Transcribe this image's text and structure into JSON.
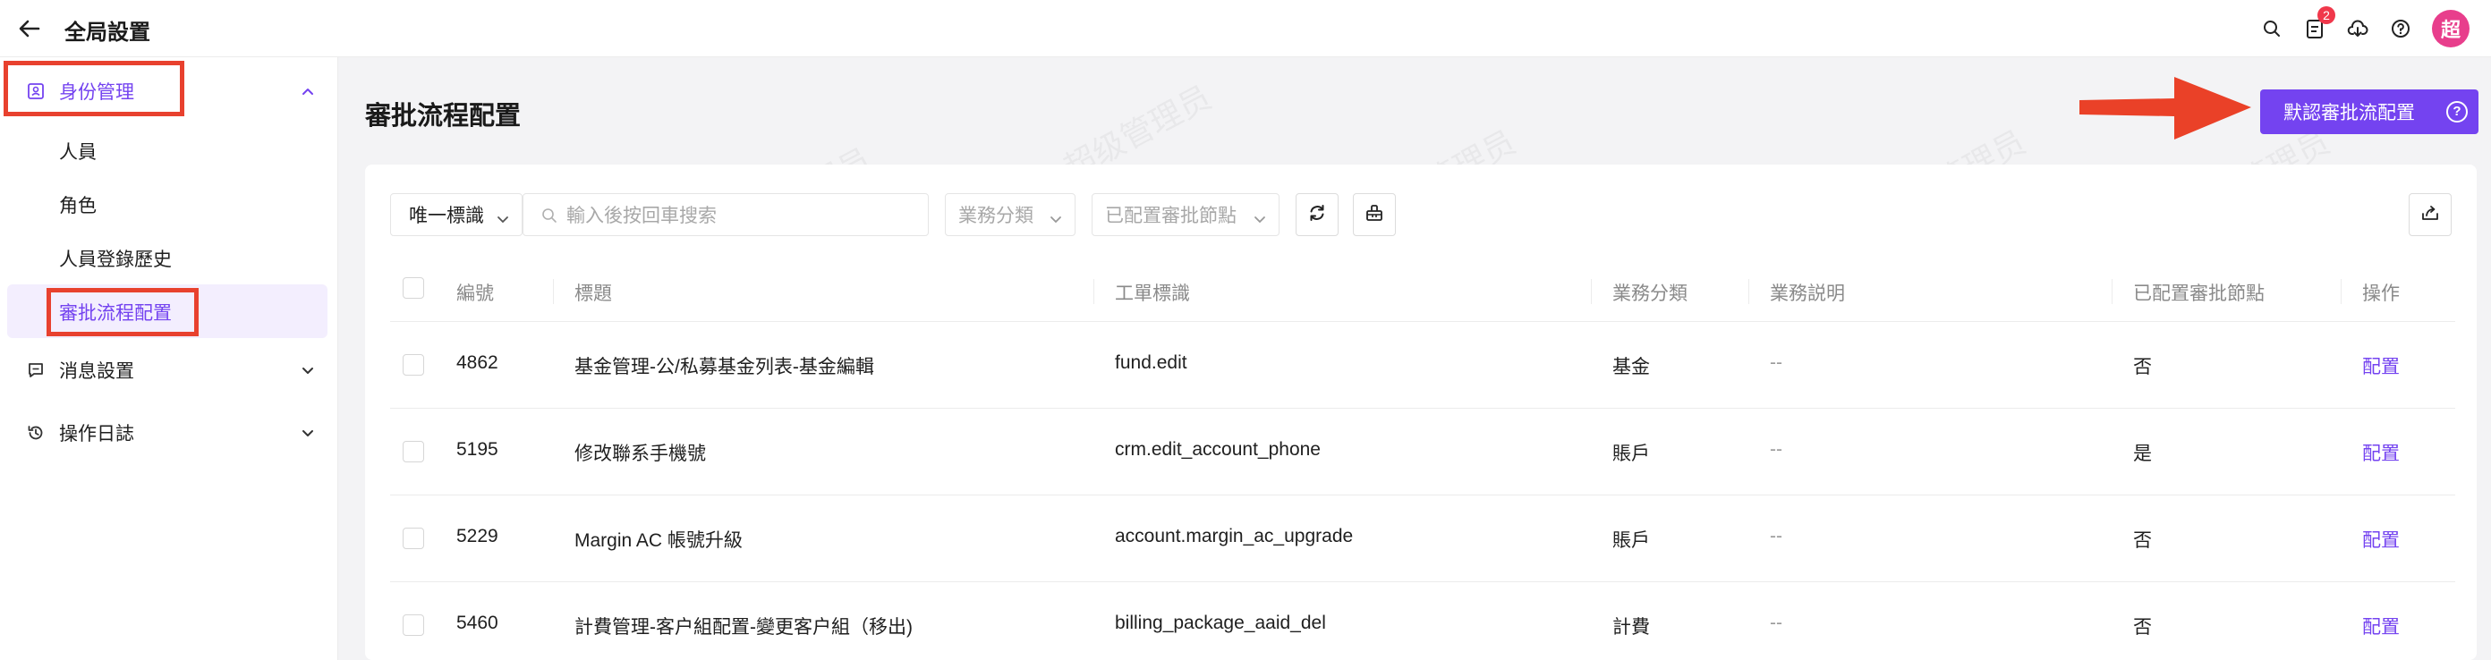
{
  "app": {
    "title": "全局設置"
  },
  "topbar": {
    "notification_count": "2",
    "avatar_text": "超"
  },
  "sidebar": {
    "groups": [
      {
        "label": "身份管理",
        "expanded": true
      },
      {
        "label": "消息設置",
        "expanded": false
      },
      {
        "label": "操作日誌",
        "expanded": false
      }
    ],
    "items": [
      {
        "label": "人員"
      },
      {
        "label": "角色"
      },
      {
        "label": "人員登錄歷史"
      },
      {
        "label": "審批流程配置",
        "active": true
      }
    ]
  },
  "page": {
    "title": "審批流程配置",
    "primary_button": "默認審批流配置",
    "help_glyph": "?"
  },
  "filters": {
    "id_select": "唯一標識",
    "search_placeholder": "輸入後按回車搜索",
    "category_placeholder": "業務分類",
    "nodes_placeholder": "已配置審批節點"
  },
  "table": {
    "columns": [
      "編號",
      "標題",
      "工單標識",
      "業務分類",
      "業務説明",
      "已配置審批節點",
      "操作"
    ],
    "rows": [
      {
        "id": "4862",
        "title": "基金管理-公/私募基金列表-基金編輯",
        "key": "fund.edit",
        "category": "基金",
        "desc": "--",
        "configured": "否",
        "action": "配置"
      },
      {
        "id": "5195",
        "title": "修改聯系手機號",
        "key": "crm.edit_account_phone",
        "category": "賬戶",
        "desc": "--",
        "configured": "是",
        "action": "配置"
      },
      {
        "id": "5229",
        "title": "Margin AC 帳號升級",
        "key": "account.margin_ac_upgrade",
        "category": "賬戶",
        "desc": "--",
        "configured": "否",
        "action": "配置"
      },
      {
        "id": "5460",
        "title": "計費管理-客户組配置-變更客户組（移出)",
        "key": "billing_package_aaid_del",
        "category": "計費",
        "desc": "--",
        "configured": "否",
        "action": "配置"
      }
    ]
  },
  "watermark": "超级管理员",
  "colors": {
    "accent": "#7443f0",
    "highlight": "#e8412e",
    "badge": "#f0384b",
    "avatar": "#e83e8c"
  }
}
